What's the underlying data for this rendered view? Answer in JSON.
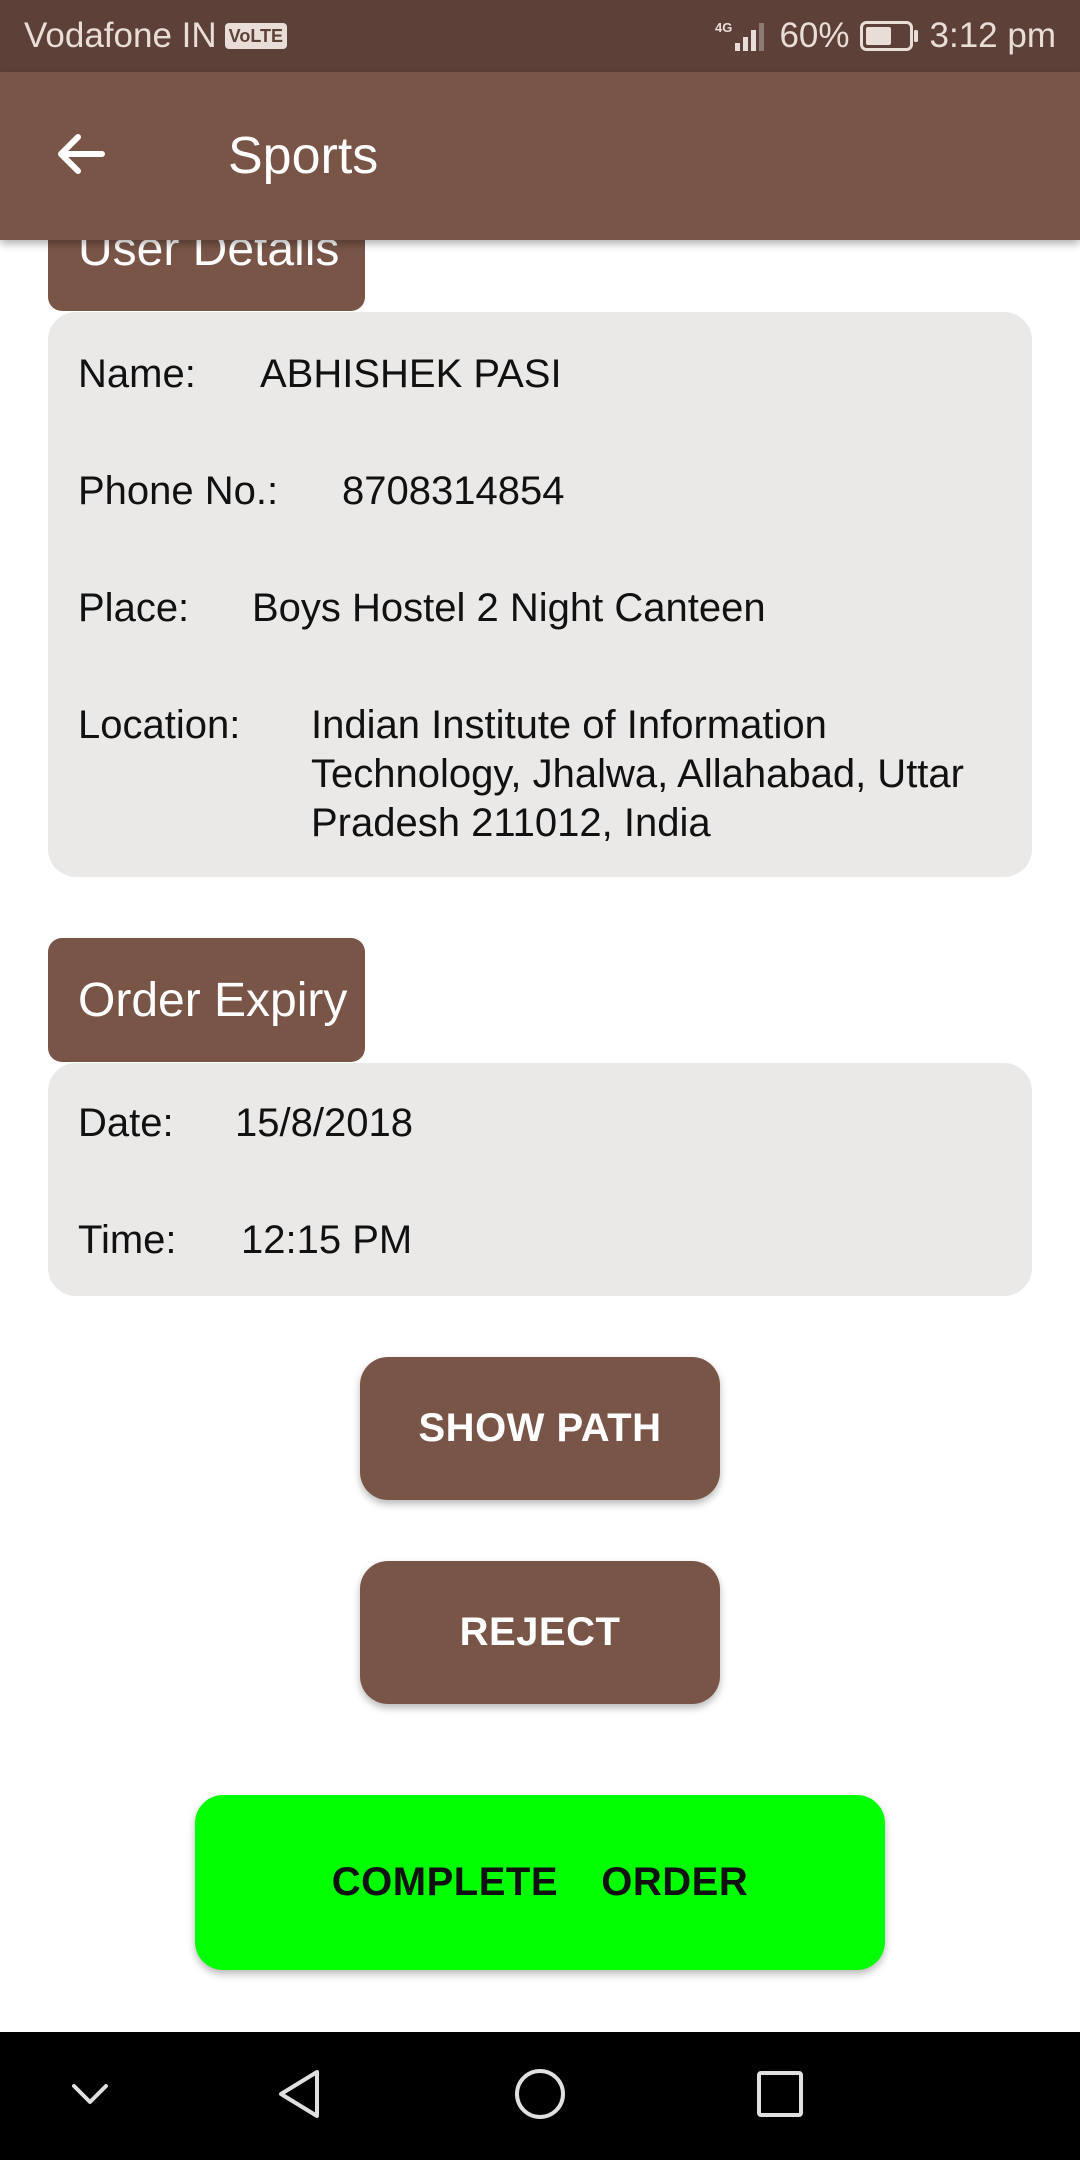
{
  "status_bar": {
    "carrier": "Vodafone IN",
    "volte": "VoLTE",
    "network": "4G",
    "battery": "60%",
    "time": "3:12 pm",
    "battery_level": 0.6
  },
  "app_bar": {
    "title": "Sports",
    "back_icon": "arrow-back-icon"
  },
  "user_details": {
    "heading": "User Details",
    "name_label": "Name:",
    "name_value": "ABHISHEK PASI",
    "phone_label": "Phone No.:",
    "phone_value": "8708314854",
    "place_label": "Place:",
    "place_value": "Boys Hostel 2 Night Canteen",
    "location_label": "Location:",
    "location_lines": [
      "Indian Institute of Information",
      "Technology, Jhalwa, Allahabad, Uttar",
      "Pradesh 211012, India"
    ]
  },
  "order_expiry": {
    "heading": "Order Expiry",
    "date_label": "Date:",
    "date_value": "15/8/2018",
    "time_label": "Time:",
    "time_value": "12:15 PM"
  },
  "actions": {
    "show_path": "SHOW PATH",
    "reject": "REJECT",
    "complete_order": "COMPLETE  ORDER"
  },
  "colors": {
    "status_bar": "#5d4037",
    "primary": "#795548",
    "card": "#ebe9e7",
    "complete": "#00ff00"
  },
  "nav_bar": {
    "icons": [
      "chevron-down-icon",
      "back-triangle-icon",
      "home-circle-icon",
      "recents-square-icon"
    ]
  }
}
